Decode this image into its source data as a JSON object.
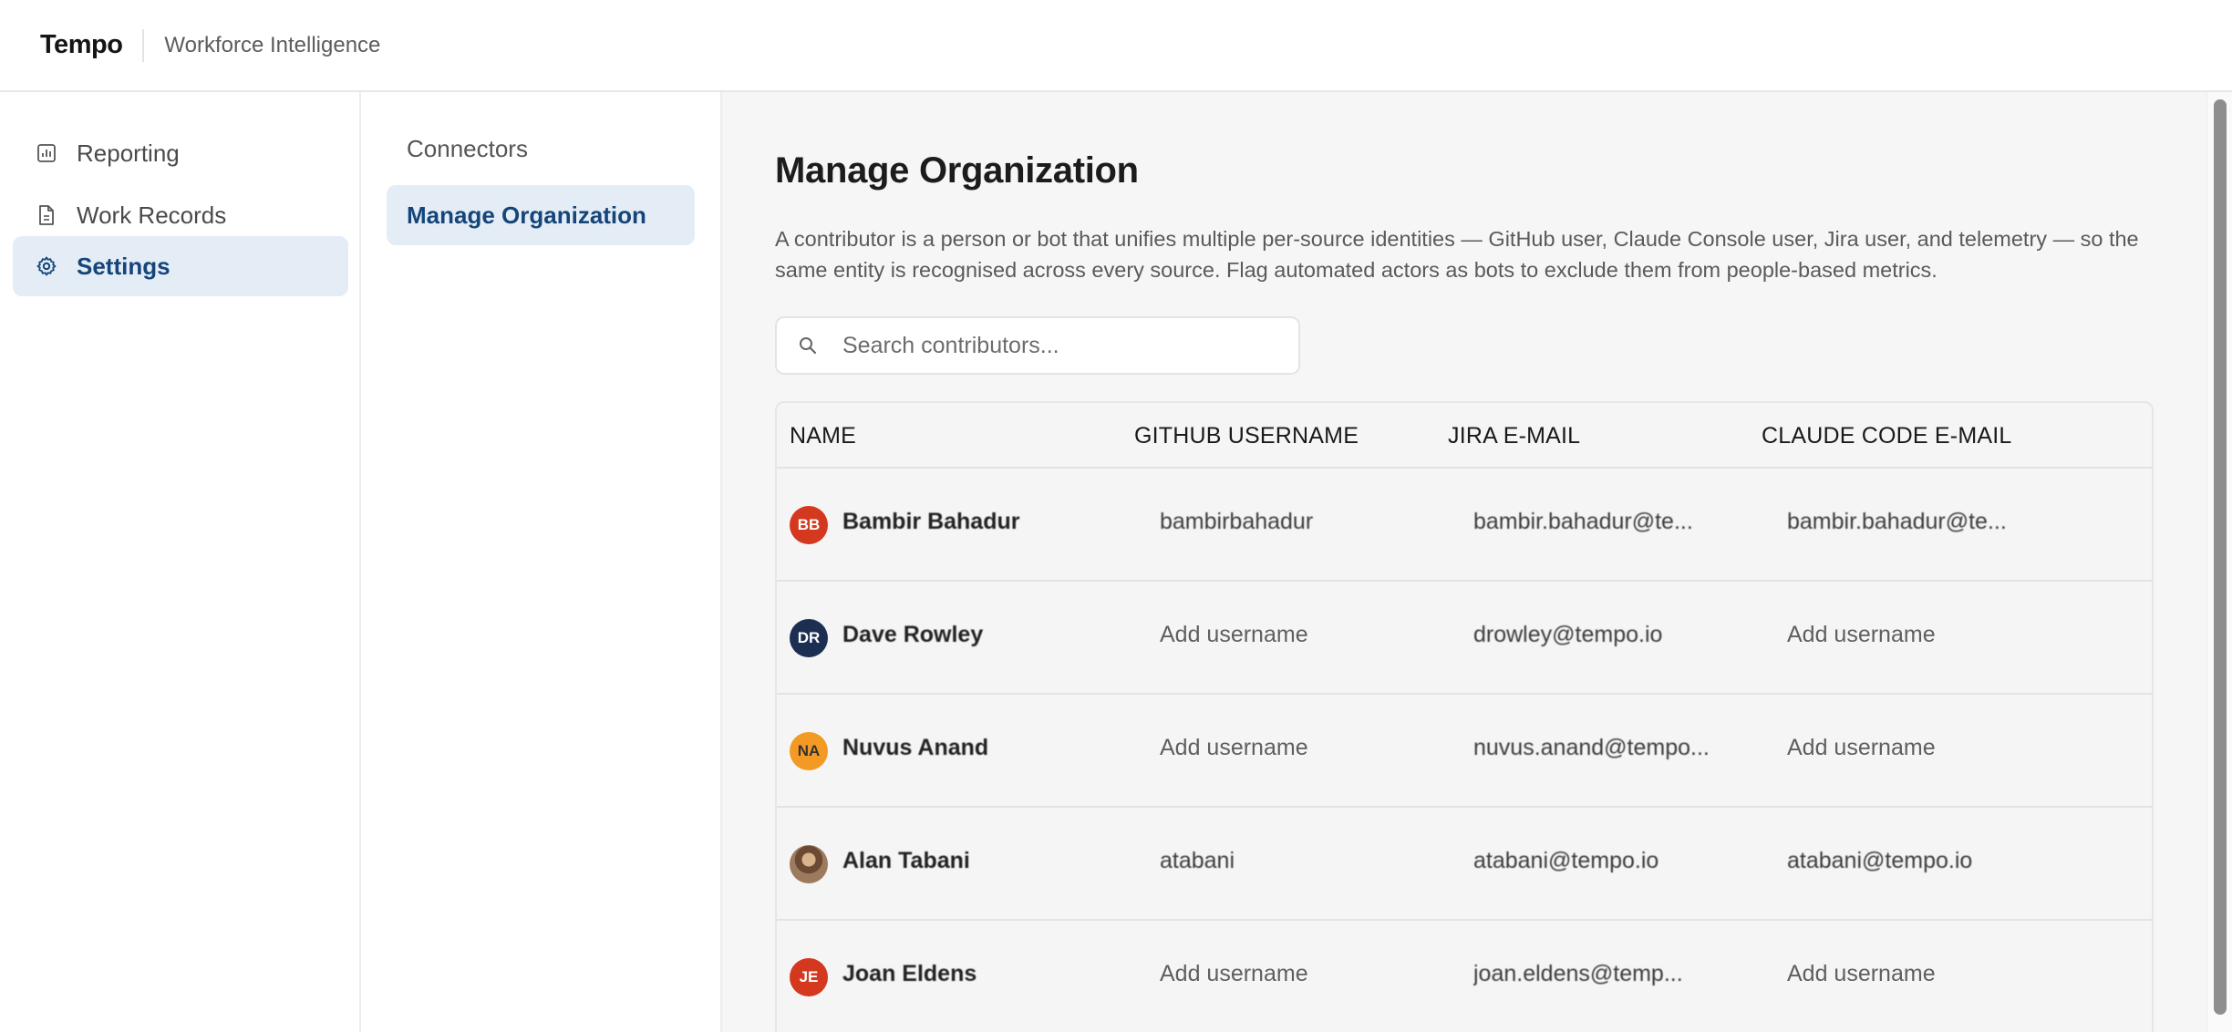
{
  "header": {
    "brand": "Tempo",
    "subtitle": "Workforce Intelligence"
  },
  "sidebar": {
    "items": [
      {
        "label": "Reporting",
        "icon": "bar-chart-icon",
        "active": false
      },
      {
        "label": "Work Records",
        "icon": "document-icon",
        "active": false
      },
      {
        "label": "Settings",
        "icon": "gear-icon",
        "active": true
      }
    ]
  },
  "subnav": {
    "items": [
      {
        "label": "Connectors",
        "active": false
      },
      {
        "label": "Manage Organization",
        "active": true
      }
    ]
  },
  "main": {
    "title": "Manage Organization",
    "description": "A contributor is a person or bot that unifies multiple per-source identities — GitHub user, Claude Console user, Jira user, and telemetry — so the same entity is recognised across every source. Flag automated actors as bots to exclude them from people-based metrics.",
    "search": {
      "placeholder": "Search contributors...",
      "icon": "search-icon"
    },
    "table": {
      "columns": [
        "NAME",
        "GITHUB USERNAME",
        "JIRA E-MAIL",
        "CLAUDE CODE E-MAIL"
      ],
      "rows": [
        {
          "initials": "BB",
          "avatar_color": "#d4381e",
          "name": "Bambir Bahadur",
          "github": "bambirbahadur",
          "jira": "bambir.bahadur@te...",
          "claude": "bambir.bahadur@te...",
          "github_placeholder": false,
          "claude_placeholder": false
        },
        {
          "initials": "DR",
          "avatar_color": "#1c2f52",
          "name": "Dave Rowley",
          "github": "Add username",
          "jira": "drowley@tempo.io",
          "claude": "Add username",
          "github_placeholder": true,
          "claude_placeholder": true
        },
        {
          "initials": "NA",
          "avatar_color": "#f39a25",
          "name": "Nuvus Anand",
          "github": "Add username",
          "jira": "nuvus.anand@tempo...",
          "claude": "Add username",
          "github_placeholder": true,
          "claude_placeholder": true
        },
        {
          "initials": "",
          "avatar_color": "#7a5a40",
          "name": "Alan Tabani",
          "github": "atabani",
          "jira": "atabani@tempo.io",
          "claude": "atabani@tempo.io",
          "github_placeholder": false,
          "claude_placeholder": false,
          "photo": true
        },
        {
          "initials": "JE",
          "avatar_color": "#d4381e",
          "name": "Joan Eldens",
          "github": "Add username",
          "jira": "joan.eldens@temp...",
          "claude": "Add username",
          "github_placeholder": true,
          "claude_placeholder": true
        }
      ]
    }
  },
  "colors": {
    "accent": "#15457a",
    "active_bg": "#e4edf6",
    "main_bg": "#f6f6f6"
  }
}
